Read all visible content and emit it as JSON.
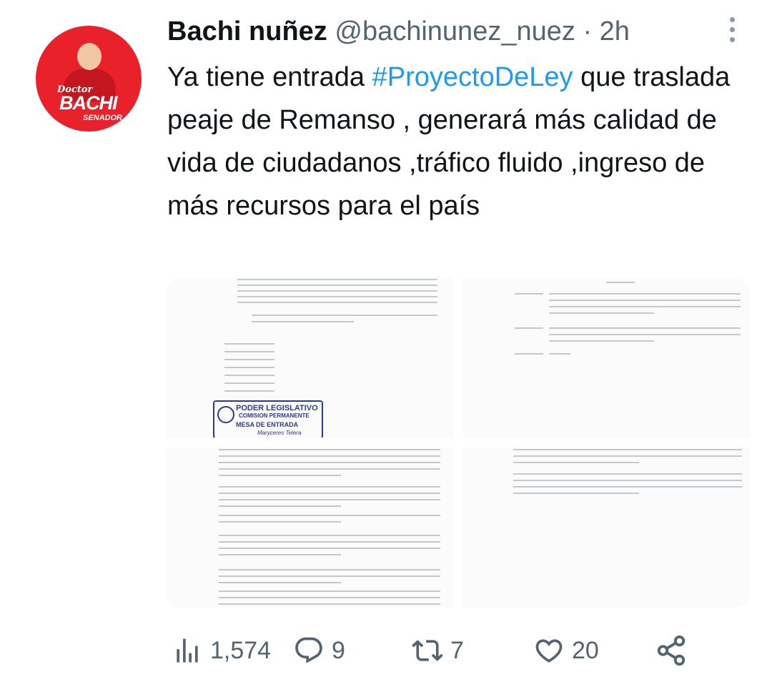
{
  "author": {
    "name": "Bachi nuñez",
    "handle": "@bachinunez_nuez",
    "separator": "·",
    "time": "2h",
    "avatar_text": {
      "line1": "Doctor",
      "line2": "BACHI",
      "line3": "SENADOR"
    }
  },
  "tweet": {
    "text_part1": "Ya tiene entrada ",
    "hashtag": "#ProyectoDeLey",
    "text_part2": " que traslada  peaje de Remanso , generará más calidad de vida de ciudadanos ,tráfico fluido ,ingreso de más recursos para el país"
  },
  "media": {
    "stamp": {
      "title": "PODER LEGISLATIVO",
      "subtitle": "COMISION PERMANENTE",
      "mesa": "MESA DE ENTRADA",
      "signature": "Maryceres Telera"
    }
  },
  "actions": {
    "views": "1,574",
    "replies": "9",
    "retweets": "7",
    "likes": "20"
  },
  "colors": {
    "hashtag": "#1d9bf0",
    "muted": "#536471",
    "avatar_bg": "#e8212b",
    "stamp": "#2b3a8c"
  }
}
